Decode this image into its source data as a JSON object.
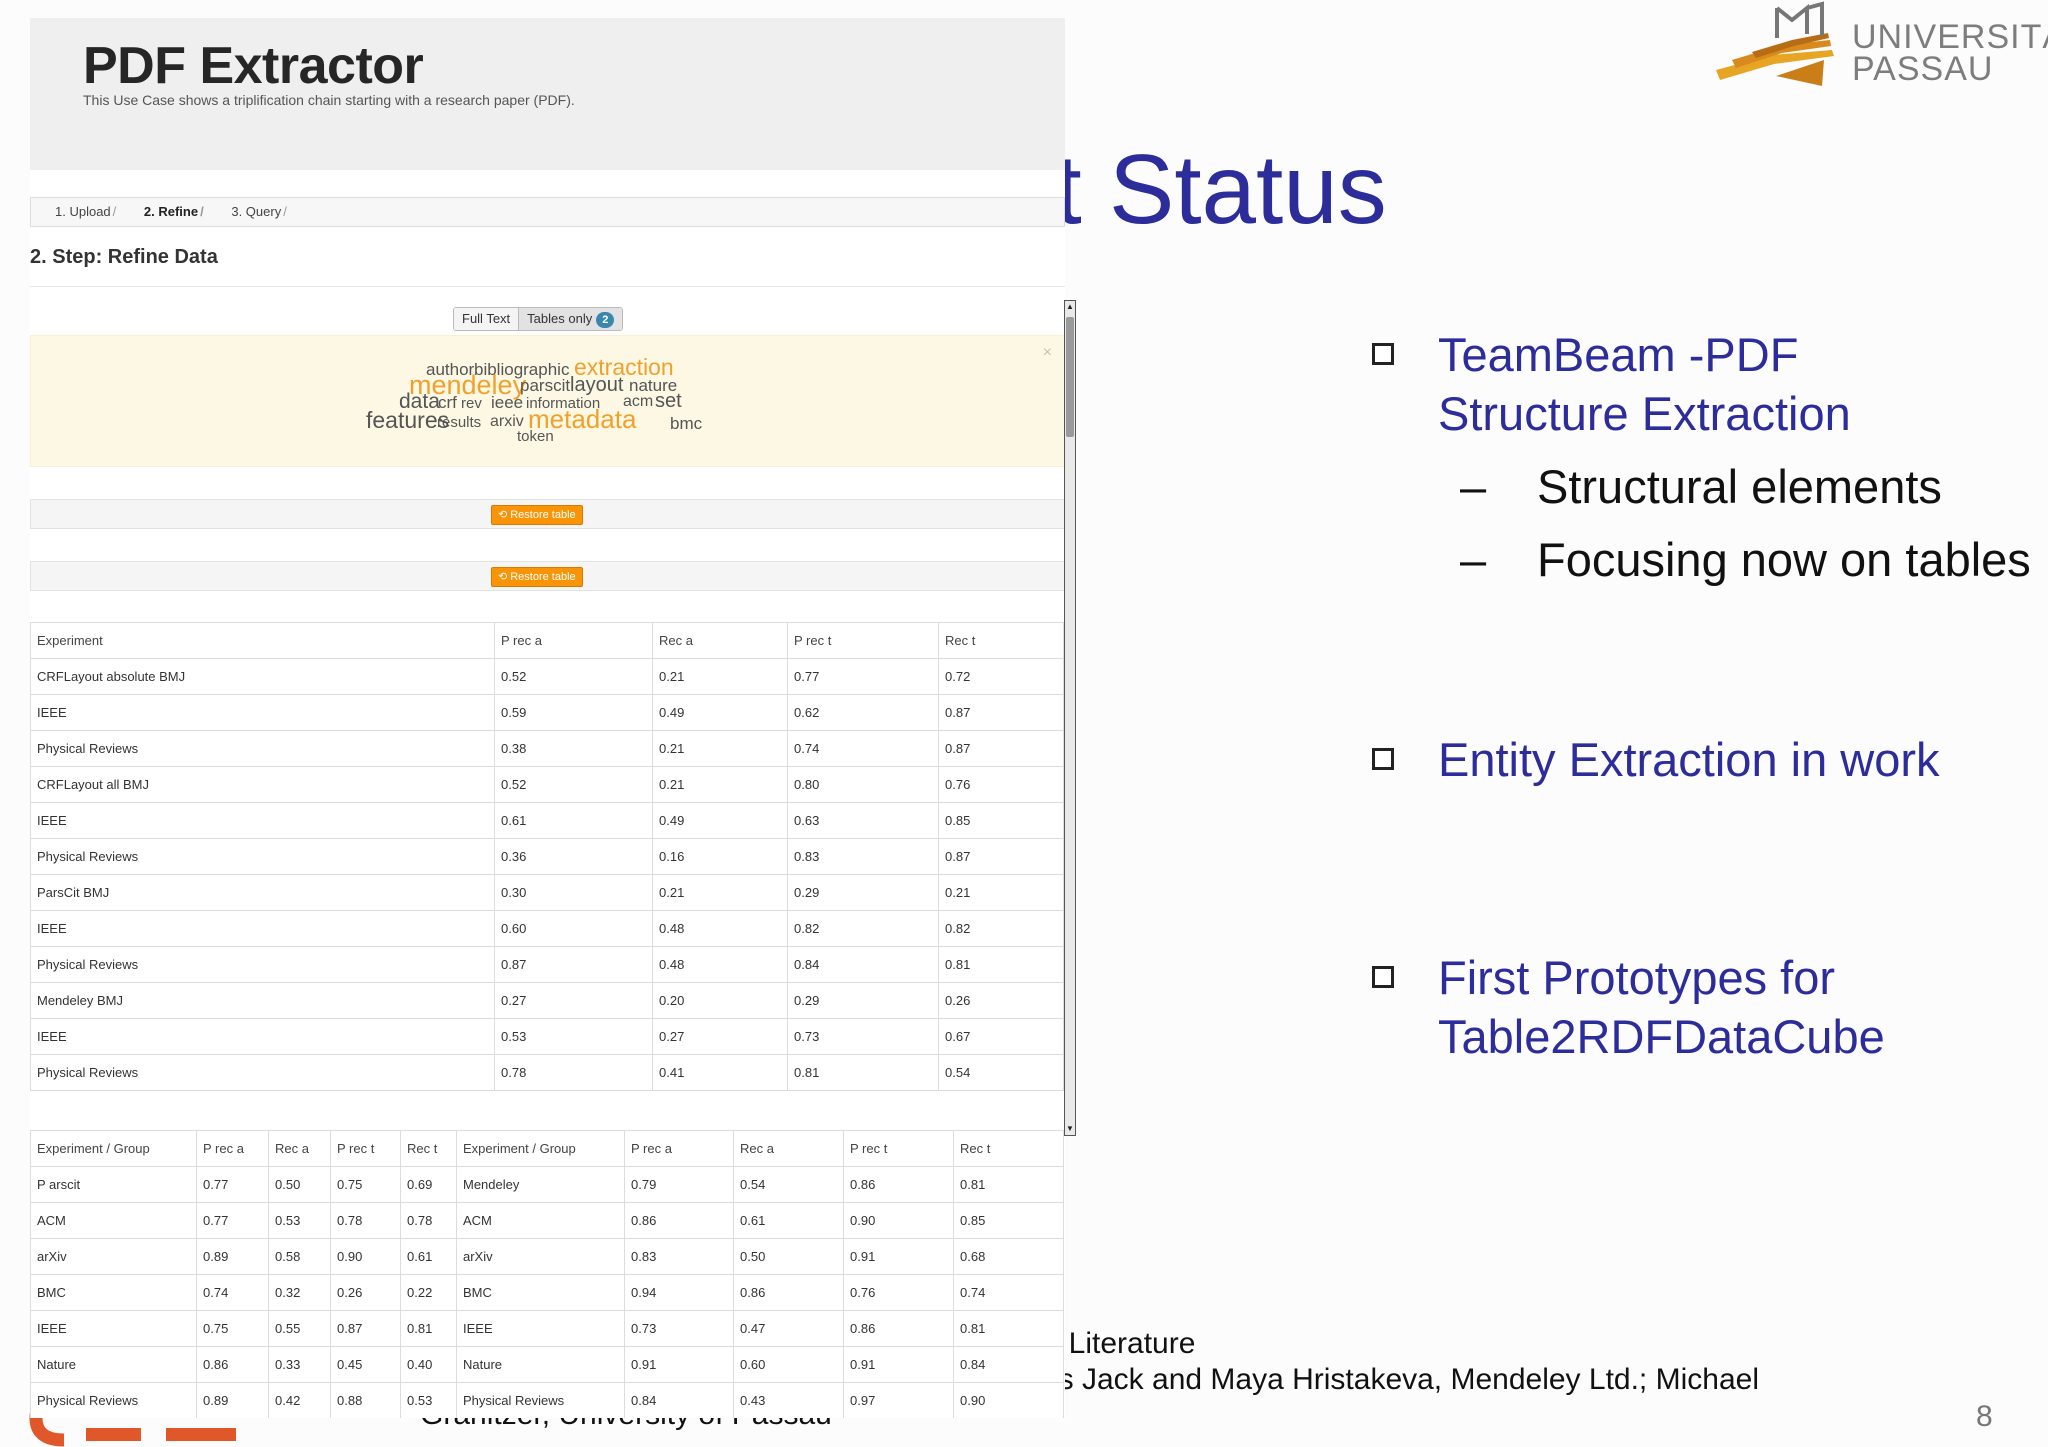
{
  "slide": {
    "title_fragment": "nt Status",
    "university": {
      "line1": "UNIVERSITÄT",
      "line2": "PASSAU"
    },
    "bullets": [
      {
        "text": "TeamBeam -PDF Structure Extraction",
        "subs": [
          "Structural elements",
          "Focusing now on tables"
        ]
      },
      {
        "text": "Entity Extraction in work",
        "subs": []
      },
      {
        "text": "First Prototypes for Table2RDFDataCube",
        "subs": []
      }
    ],
    "footer": {
      "line1": ": Literature",
      "line2": "is Jack and Maya Hristakeva, Mendeley Ltd.; Michael",
      "line3": "Granitzer, University of Passau"
    },
    "page_number": "8"
  },
  "app": {
    "title": "PDF Extractor",
    "subtitle": "This Use Case shows a triplification chain starting with a research paper (PDF).",
    "breadcrumb": [
      {
        "label": "1. Upload",
        "active": false
      },
      {
        "label": "2. Refine",
        "active": true
      },
      {
        "label": "3. Query",
        "active": false
      }
    ],
    "breadcrumb_sep": "/",
    "step_title": "2. Step: Refine Data",
    "toggle": {
      "full_text": "Full Text",
      "tables_only": "Tables only",
      "count": "2"
    },
    "close_glyph": "×",
    "word_cloud": [
      {
        "word": "author",
        "color": "#555555"
      },
      {
        "word": "bibliographic",
        "color": "#555555"
      },
      {
        "word": "extraction",
        "color": "#f0a12c"
      },
      {
        "word": "mendeley",
        "color": "#f0a12c"
      },
      {
        "word": "parscit",
        "color": "#555555"
      },
      {
        "word": "layout",
        "color": "#555555"
      },
      {
        "word": "nature",
        "color": "#555555"
      },
      {
        "word": "data",
        "color": "#555555"
      },
      {
        "word": "crf",
        "color": "#555555"
      },
      {
        "word": "rev",
        "color": "#555555"
      },
      {
        "word": "ieee",
        "color": "#555555"
      },
      {
        "word": "information",
        "color": "#555555"
      },
      {
        "word": "acm",
        "color": "#555555"
      },
      {
        "word": "set",
        "color": "#555555"
      },
      {
        "word": "features",
        "color": "#555555"
      },
      {
        "word": "results",
        "color": "#555555"
      },
      {
        "word": "arxiv",
        "color": "#555555"
      },
      {
        "word": "metadata",
        "color": "#f0a12c"
      },
      {
        "word": "bmc",
        "color": "#555555"
      },
      {
        "word": "token",
        "color": "#555555"
      }
    ],
    "restore_label": "Restore table",
    "table1": {
      "headers": [
        "Experiment",
        "P rec a",
        "Rec a",
        "P rec t",
        "Rec t"
      ],
      "rows": [
        [
          "CRFLayout absolute BMJ",
          "0.52",
          "0.21",
          "0.77",
          "0.72"
        ],
        [
          "IEEE",
          "0.59",
          "0.49",
          "0.62",
          "0.87"
        ],
        [
          "Physical Reviews",
          "0.38",
          "0.21",
          "0.74",
          "0.87"
        ],
        [
          "CRFLayout all BMJ",
          "0.52",
          "0.21",
          "0.80",
          "0.76"
        ],
        [
          "IEEE",
          "0.61",
          "0.49",
          "0.63",
          "0.85"
        ],
        [
          "Physical Reviews",
          "0.36",
          "0.16",
          "0.83",
          "0.87"
        ],
        [
          "ParsCit BMJ",
          "0.30",
          "0.21",
          "0.29",
          "0.21"
        ],
        [
          "IEEE",
          "0.60",
          "0.48",
          "0.82",
          "0.82"
        ],
        [
          "Physical Reviews",
          "0.87",
          "0.48",
          "0.84",
          "0.81"
        ],
        [
          "Mendeley BMJ",
          "0.27",
          "0.20",
          "0.29",
          "0.26"
        ],
        [
          "IEEE",
          "0.53",
          "0.27",
          "0.73",
          "0.67"
        ],
        [
          "Physical Reviews",
          "0.78",
          "0.41",
          "0.81",
          "0.54"
        ]
      ]
    },
    "table2": {
      "headers": [
        "Experiment / Group",
        "P rec a",
        "Rec a",
        "P rec t",
        "Rec t",
        "Experiment / Group",
        "P rec a",
        "Rec a",
        "P rec t",
        "Rec t"
      ],
      "rows": [
        [
          "P arscit",
          "0.77",
          "0.50",
          "0.75",
          "0.69",
          "Mendeley",
          "0.79",
          "0.54",
          "0.86",
          "0.81"
        ],
        [
          "ACM",
          "0.77",
          "0.53",
          "0.78",
          "0.78",
          "ACM",
          "0.86",
          "0.61",
          "0.90",
          "0.85"
        ],
        [
          "arXiv",
          "0.89",
          "0.58",
          "0.90",
          "0.61",
          "arXiv",
          "0.83",
          "0.50",
          "0.91",
          "0.68"
        ],
        [
          "BMC",
          "0.74",
          "0.32",
          "0.26",
          "0.22",
          "BMC",
          "0.94",
          "0.86",
          "0.76",
          "0.74"
        ],
        [
          "IEEE",
          "0.75",
          "0.55",
          "0.87",
          "0.81",
          "IEEE",
          "0.73",
          "0.47",
          "0.86",
          "0.81"
        ],
        [
          "Nature",
          "0.86",
          "0.33",
          "0.45",
          "0.40",
          "Nature",
          "0.91",
          "0.60",
          "0.91",
          "0.84"
        ],
        [
          "Physical Reviews",
          "0.89",
          "0.42",
          "0.88",
          "0.53",
          "Physical Reviews",
          "0.84",
          "0.43",
          "0.97",
          "0.90"
        ]
      ]
    }
  },
  "colors": {
    "slide_blue": "#2c2c9b",
    "cloud_highlight": "#f0a12c",
    "restore_button": "#f89406",
    "badge": "#3a87ad"
  }
}
